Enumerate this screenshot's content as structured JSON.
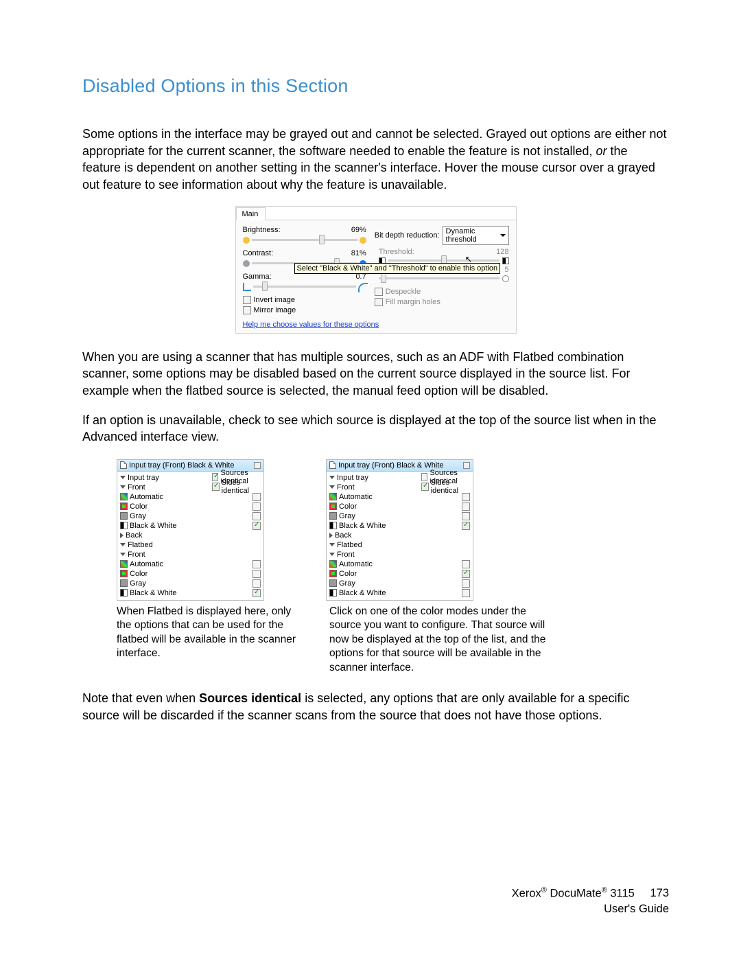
{
  "section_title": "Disabled Options in this Section",
  "para1_a": "Some options in the interface may be grayed out and cannot be selected. Grayed out options are either not appropriate for the current scanner, the software needed to enable the feature is not installed, ",
  "para1_or": "or",
  "para1_b": " the feature is dependent on another setting in the scanner's interface. Hover the mouse cursor over a grayed out feature to see information about why the feature is unavailable.",
  "main_panel": {
    "tab": "Main",
    "brightness": {
      "label": "Brightness:",
      "value": "69%",
      "thumb_pct": 69,
      "c1": "#f9c23c",
      "c2": "#f9c23c"
    },
    "contrast": {
      "label": "Contrast:",
      "value": "81%",
      "thumb_pct": 81,
      "c1": "#9aa0a6",
      "c2": "#1a73e8"
    },
    "gamma": {
      "label": "Gamma:",
      "value": "0.7",
      "thumb_pct": 12
    },
    "invert": "Invert image",
    "mirror": "Mirror image",
    "tooltip": "Select \"Black & White\" and \"Threshold\" to enable this option",
    "help": "Help me choose values for these options",
    "bit_depth_label": "Bit depth reduction:",
    "bit_depth_value": "Dynamic threshold",
    "threshold_label": "Threshold:",
    "threshold_value": "128",
    "sensitivity_value": "5",
    "despeckle": "Despeckle",
    "fill_margin": "Fill margin holes"
  },
  "para2": "When you are using a scanner that has multiple sources, such as an ADF with Flatbed combination scanner, some options may be disabled based on the current source displayed in the source list. For example when the flatbed source is selected, the manual feed option will be disabled.",
  "para3": "If an option is unavailable, check to see which source is displayed at the top of the source list when in the Advanced interface view.",
  "tree": {
    "header": "Input tray (Front) Black & White",
    "sources_identical": "Sources identical",
    "sides_identical": "Sides identical",
    "input_tray": "Input tray",
    "front": "Front",
    "back": "Back",
    "flatbed": "Flatbed",
    "automatic": "Automatic",
    "color": "Color",
    "gray": "Gray",
    "bw": "Black & White"
  },
  "left_checks": {
    "sources": true,
    "sides": true,
    "it_auto": false,
    "it_color": false,
    "it_gray": false,
    "it_bw": true,
    "fb_auto": false,
    "fb_color": false,
    "fb_gray": false,
    "fb_bw": true
  },
  "right_checks": {
    "sources": false,
    "sides": true,
    "it_auto": false,
    "it_color": false,
    "it_gray": false,
    "it_bw": true,
    "fb_auto": false,
    "fb_color": true,
    "fb_gray": false,
    "fb_bw": false
  },
  "caption_left": "When Flatbed is displayed here, only the options that can be used for the flatbed will be available in the scanner interface.",
  "caption_right": "Click on one of the color modes under the source you want to configure.  That source will now be displayed at the top of the list, and the options for that source will be available in the scanner interface.",
  "para4_a": "Note that even when ",
  "para4_bold": "Sources identical",
  "para4_b": " is selected, any options that are only available for a specific source will be discarded if the scanner scans from the source that does not have those options.",
  "footer": {
    "line1_a": "Xerox",
    "line1_b": " DocuMate",
    "line1_c": " 3115",
    "page": "173",
    "line2": "User's Guide"
  }
}
